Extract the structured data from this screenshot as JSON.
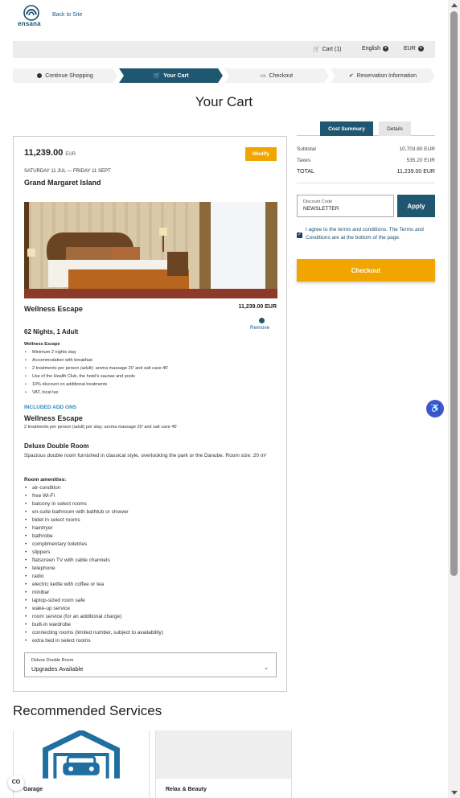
{
  "header": {
    "logo_text": "ensana",
    "back_link": "Back to Site"
  },
  "topbar": {
    "cart": "Cart (1)",
    "language": "English",
    "currency": "EUR"
  },
  "steps": [
    "Continue Shopping",
    "Your Cart",
    "Checkout",
    "Reservation Information"
  ],
  "page_title": "Your Cart",
  "summary": {
    "tab_active": "Cost Summary",
    "tab_other": "Details",
    "rows": [
      {
        "label": "Subtotal",
        "value": "10,703.80 EUR"
      },
      {
        "label": "Taxes",
        "value": "535.20 EUR"
      },
      {
        "label": "TOTAL",
        "value": "11,239.00 EUR"
      }
    ],
    "discount_label": "Discount Code",
    "discount_value": "NEWSLETTER",
    "apply": "Apply",
    "terms": "I agree to the terms and conditions. The Terms and Conditions are at the bottom of the page.",
    "checkout": "Checkout"
  },
  "cart": {
    "price": "11,239.00",
    "currency": "EUR",
    "modify": "Modify",
    "dates": "SATURDAY 11 JUL — FRIDAY 11 SEPT",
    "hotel": "Grand Margaret Island",
    "package_name": "Wellness Escape",
    "package_price": "11,239.00 EUR",
    "remove": "Remove",
    "nights": "62 Nights, 1 Adult",
    "package_heading": "Wellness Escape",
    "package_items": [
      "Minimum 2 nights stay",
      "Accommodation with breakfast",
      "2 treatments per person (adult): aroma massage 20' and salt cave 45'",
      "Use of the Health Club, the hotel's saunas and pools",
      "10% discount on additional treatments",
      "VAT, local tax"
    ],
    "addons_heading": "INCLUDED ADD ONS",
    "addon_name": "Wellness Escape",
    "addon_desc": "2 treatments per person (adult) per stay: aroma massage 20' and salt cave 45'",
    "room_name": "Deluxe Double Room",
    "room_desc": "Spacious double room furnished in classical style, overlooking the park or the Danube. Room size: 20 m²",
    "amenities_heading": "Room amenities:",
    "amenities": [
      "air-condition",
      "free Wi-Fi",
      "balcony in select rooms",
      "en-suite bathroom with bathtub or shower",
      "bidet in select rooms",
      "hairdryer",
      "bathrobe",
      "complimentary toiletries",
      "slippers",
      "flatscreen TV with cable channels",
      "telephone",
      "radio",
      "electric kettle with coffee or tea",
      "minibar",
      "laptop-sized room safe",
      "wake-up service",
      "room service (for an additional charge)",
      "built-in wardrobe",
      "connecting rooms (limited number, subject to availability)",
      "extra bed in select rooms"
    ],
    "select_label": "Deluxe Double Room",
    "select_value": "Upgrades Available"
  },
  "recommended": {
    "heading": "Recommended Services",
    "items": [
      "Garage",
      "Relax & Beauty"
    ]
  },
  "cookie_icon": "CO",
  "colors": {
    "primary": "#1f5670",
    "accent": "#f0a500",
    "link": "#2a8bc0"
  }
}
